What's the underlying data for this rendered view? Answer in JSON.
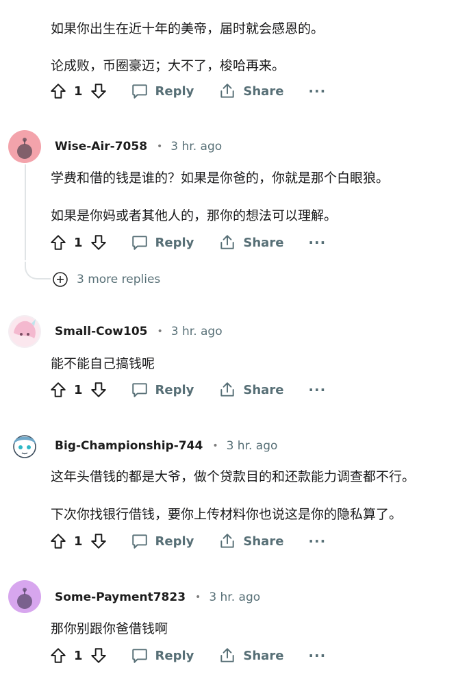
{
  "comments": [
    {
      "paragraphs": [
        "如果你出生在近十年的美帝，届时就会感恩的。",
        "论成败，币圈豪迈；大不了，梭哈再来。"
      ],
      "votes": "1",
      "reply_label": "Reply",
      "share_label": "Share",
      "more_label": "···"
    },
    {
      "username": "Wise-Air-7058",
      "separator": "•",
      "time": "3 hr. ago",
      "avatar_color": "#f3a3ab",
      "paragraphs": [
        "学费和借的钱是谁的？如果是你爸的，你就是那个白眼狼。",
        "如果是你妈或者其他人的，那你的想法可以理解。"
      ],
      "votes": "1",
      "reply_label": "Reply",
      "share_label": "Share",
      "more_label": "···",
      "more_replies": "3 more replies"
    },
    {
      "username": "Small-Cow105",
      "separator": "•",
      "time": "3 hr. ago",
      "paragraphs": [
        "能不能自己搞钱呢"
      ],
      "votes": "1",
      "reply_label": "Reply",
      "share_label": "Share",
      "more_label": "···"
    },
    {
      "username": "Big-Championship-744",
      "separator": "•",
      "time": "3 hr. ago",
      "paragraphs": [
        "这年头借钱的都是大爷，做个贷款目的和还款能力调查都不行。",
        "下次你找银行借钱，要你上传材料你也说这是你的隐私算了。"
      ],
      "votes": "1",
      "reply_label": "Reply",
      "share_label": "Share",
      "more_label": "···"
    },
    {
      "username": "Some-Payment7823",
      "separator": "•",
      "time": "3 hr. ago",
      "avatar_color": "#d7a6ee",
      "paragraphs": [
        "那你别跟你爸借钱啊"
      ],
      "votes": "1",
      "reply_label": "Reply",
      "share_label": "Share",
      "more_label": "···"
    }
  ],
  "colors": {
    "meta": "#576f76",
    "text": "#1a1a1b",
    "thread": "#e0e4e6"
  },
  "icons": [
    "upvote-icon",
    "downvote-icon",
    "reply-bubble-icon",
    "share-icon",
    "more-dots-icon",
    "plus-circle-icon"
  ]
}
